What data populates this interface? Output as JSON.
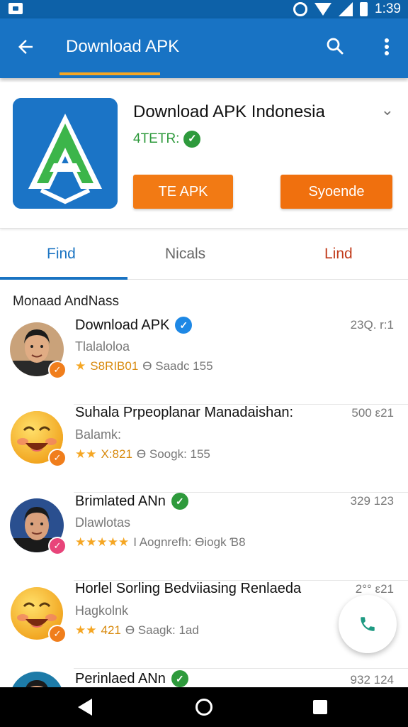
{
  "status_bar": {
    "time": "1:39"
  },
  "app_bar": {
    "title": "Download APK"
  },
  "app": {
    "name": "Download APK Indonesia",
    "rating": "4TETR:",
    "primary_button": "TE APK",
    "secondary_button": "Syoende"
  },
  "tabs": [
    {
      "label": "Find"
    },
    {
      "label": "Nicals"
    },
    {
      "label": "Lind"
    }
  ],
  "section_title": "Monaad AndNass",
  "list": [
    {
      "title": "Download APK",
      "subtitle": "Tlalaloloa",
      "stars": "★",
      "points": "S8RIB01",
      "extra": "Ɵ Saadc 155",
      "right": "23Q. r:1",
      "verified": "blue",
      "avatar": "man-1"
    },
    {
      "title": "Suhala Prpeoplanar Manadaishan:",
      "subtitle": "Balamk:",
      "stars": "★★",
      "points": "X:821",
      "extra": "Ɵ Soogk: 155",
      "right": "500 ε21",
      "verified": "none",
      "avatar": "emoji"
    },
    {
      "title": "Brimlated ANn",
      "subtitle": "Dlawlotas",
      "stars": "★★★★★",
      "points": "",
      "extra": "I Aognrefh: Ɵiogk Ɓ8",
      "right": "329 123",
      "verified": "green",
      "avatar": "man-2"
    },
    {
      "title": "Horlel Sorling Bedviiasing Renlaeda",
      "subtitle": "Hagkolnk",
      "stars": "★★",
      "points": "421",
      "extra": "Ɵ Saagk: 1ad",
      "right": "2°° ε21",
      "verified": "none",
      "avatar": "emoji"
    },
    {
      "title": "Perinlaed ANn",
      "subtitle": "",
      "stars": "",
      "points": "",
      "extra": "",
      "right": "932 124",
      "verified": "green",
      "avatar": "man-3"
    }
  ],
  "icons": {
    "back": "arrow-left-icon",
    "search": "search-icon",
    "more": "more-vert-icon",
    "fab": "phone-icon"
  },
  "colors": {
    "app_bar": "#1873c4",
    "status_bar": "#0d61a8",
    "accent_orange": "#f27a14",
    "tab_active": "#1a73c2",
    "verified_green": "#2e9a3c"
  }
}
